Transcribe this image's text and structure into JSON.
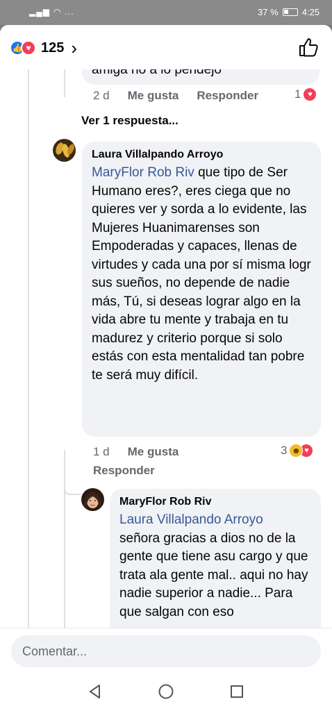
{
  "status_bar": {
    "left_icons": "...",
    "battery_percent": "37 %",
    "time": "4:25"
  },
  "header": {
    "reaction_count": "125"
  },
  "comments": {
    "prev": {
      "partial_text": "amiga no a lo pendejo",
      "time": "2 d",
      "like_label": "Me gusta",
      "reply_label": "Responder",
      "reactions": "1"
    },
    "view_replies": "Ver 1 respuesta...",
    "laura": {
      "author": "Laura Villalpando Arroyo",
      "mention": "MaryFlor Rob Riv",
      "text": " que tipo de Ser Humano eres?, eres ciega que no quieres ver y sorda a lo evidente, las Mujeres Huanimarenses son Empoderadas y capaces, llenas de virtudes y cada una por sí misma logr sus sueños, no depende de nadie más, Tú, si deseas lograr algo en la vida abre tu mente y trabaja en tu madurez y criterio porque si solo estás con esta mentalidad tan pobre te será muy difícil.",
      "time": "1 d",
      "like_label": "Me gusta",
      "reply_label": "Responder",
      "reactions": "3"
    },
    "maryflor": {
      "author": "MaryFlor Rob Riv",
      "mention": "Laura Villalpando Arroyo",
      "text": "señora gracias a dios no de la gente que tiene asu cargo y que trata ala gente mal.. aqui no hay nadie superior a nadie... Para que salgan con eso"
    }
  },
  "composer": {
    "placeholder": "Comentar..."
  },
  "icons": {
    "like": "thumbs-up-icon",
    "love": "heart-icon",
    "haha": "laughing-face-icon",
    "back": "triangle-back-icon",
    "home": "circle-home-icon",
    "recents": "square-recents-icon"
  },
  "colors": {
    "facebook_blue": "#1877f2",
    "love_red": "#f33e58",
    "mention_blue": "#385898",
    "bubble_grey": "#f0f2f5"
  }
}
